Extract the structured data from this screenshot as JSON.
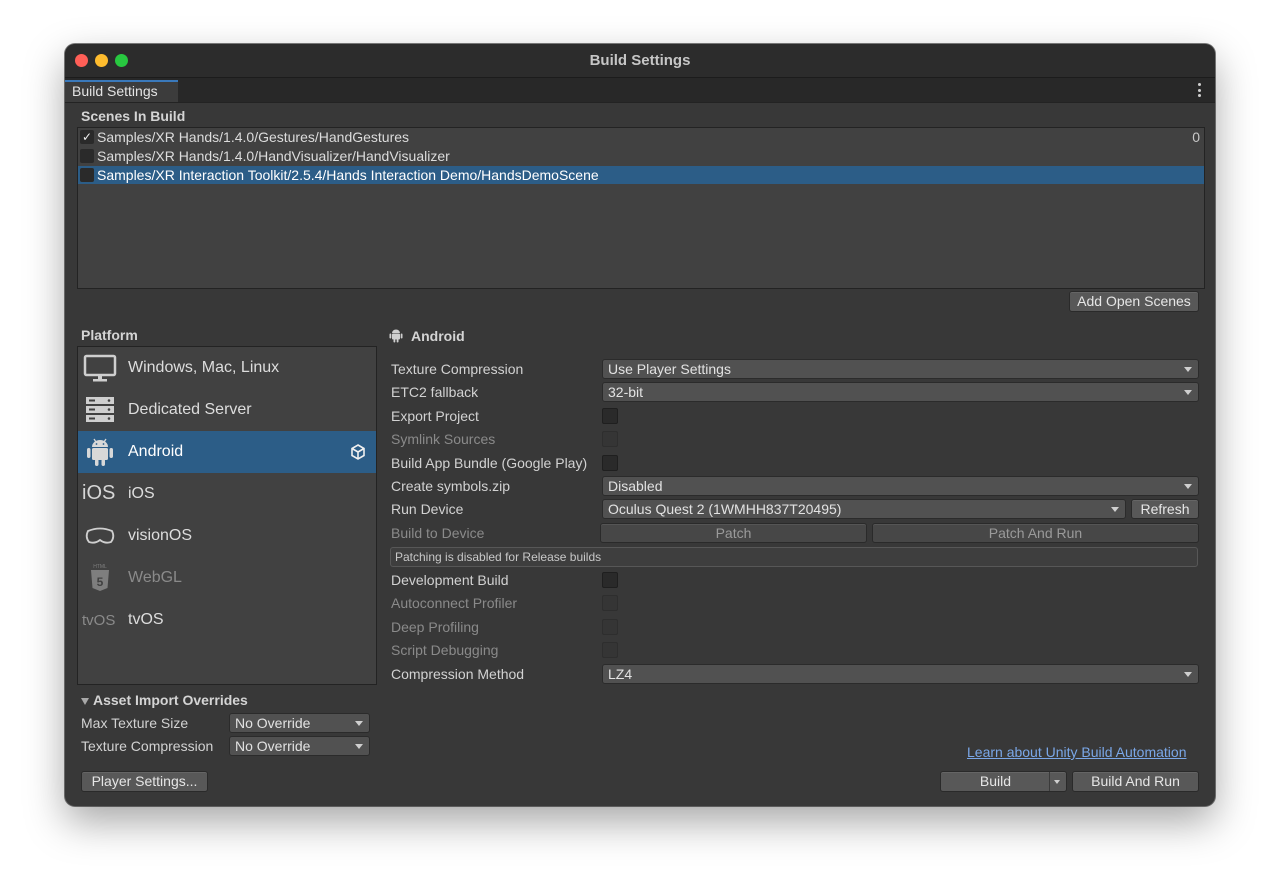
{
  "window": {
    "title": "Build Settings",
    "tab_label": "Build Settings"
  },
  "scenes": {
    "heading": "Scenes In Build",
    "items": [
      {
        "path": "Samples/XR Hands/1.4.0/Gestures/HandGestures",
        "checked": true,
        "index": "0"
      },
      {
        "path": "Samples/XR Hands/1.4.0/HandVisualizer/HandVisualizer",
        "checked": false,
        "index": ""
      },
      {
        "path": "Samples/XR Interaction Toolkit/2.5.4/Hands Interaction Demo/HandsDemoScene",
        "checked": false,
        "index": "",
        "selected": true
      }
    ],
    "add_open_scenes_label": "Add Open Scenes"
  },
  "platform": {
    "heading": "Platform",
    "items": [
      {
        "label": "Windows, Mac, Linux",
        "icon": "monitor-icon",
        "selected": false,
        "disabled": false
      },
      {
        "label": "Dedicated Server",
        "icon": "server-icon",
        "selected": false,
        "disabled": false
      },
      {
        "label": "Android",
        "icon": "android-icon",
        "selected": true,
        "disabled": false
      },
      {
        "label": "iOS",
        "icon": "ios-icon",
        "selected": false,
        "disabled": false
      },
      {
        "label": "visionOS",
        "icon": "vision-headset-icon",
        "selected": false,
        "disabled": false
      },
      {
        "label": "WebGL",
        "icon": "html5-icon",
        "selected": false,
        "disabled": true
      },
      {
        "label": "tvOS",
        "icon": "tvos-icon",
        "selected": false,
        "disabled": false
      }
    ],
    "ios_icon_text": "iOS",
    "tvos_icon_text": "tvOS"
  },
  "asset_import": {
    "heading": "Asset Import Overrides",
    "max_texture_size_label": "Max Texture Size",
    "max_texture_size_value": "No Override",
    "texture_compression_label": "Texture Compression",
    "texture_compression_value": "No Override"
  },
  "android": {
    "heading": "Android",
    "texture_compression_label": "Texture Compression",
    "texture_compression_value": "Use Player Settings",
    "etc2_fallback_label": "ETC2 fallback",
    "etc2_fallback_value": "32-bit",
    "export_project_label": "Export Project",
    "symlink_sources_label": "Symlink Sources",
    "build_app_bundle_label": "Build App Bundle (Google Play)",
    "create_symbols_label": "Create symbols.zip",
    "create_symbols_value": "Disabled",
    "run_device_label": "Run Device",
    "run_device_value": "Oculus Quest 2 (1WMHH837T20495)",
    "refresh_label": "Refresh",
    "build_to_device_label": "Build to Device",
    "patch_label": "Patch",
    "patch_and_run_label": "Patch And Run",
    "patching_notice": "Patching is disabled for Release builds",
    "development_build_label": "Development Build",
    "autoconnect_profiler_label": "Autoconnect Profiler",
    "deep_profiling_label": "Deep Profiling",
    "script_debugging_label": "Script Debugging",
    "compression_method_label": "Compression Method",
    "compression_method_value": "LZ4"
  },
  "footer": {
    "learn_link": "Learn about Unity Build Automation",
    "player_settings_label": "Player Settings...",
    "build_label": "Build",
    "build_and_run_label": "Build And Run"
  },
  "colors": {
    "selection": "#2c5d87",
    "panel": "#383838",
    "link": "#7aa7e8"
  }
}
